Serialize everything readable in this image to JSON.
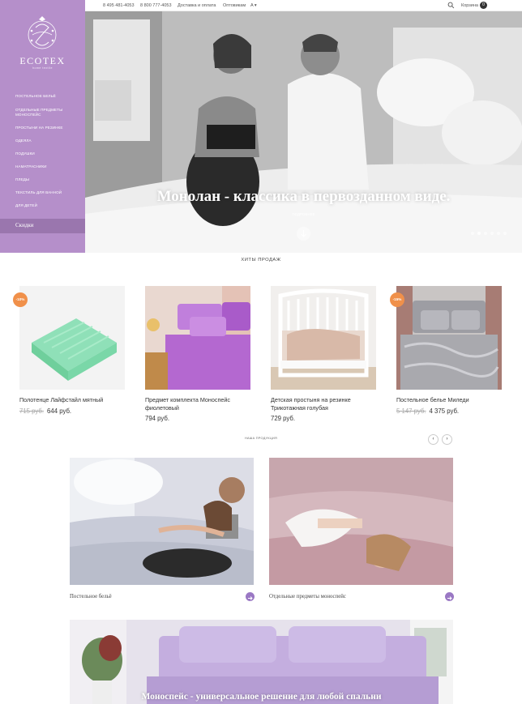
{
  "topbar": {
    "phone1": "8 495 481-4053",
    "phone2": "8 800 777-4053",
    "delivery": "Доставка и оплата",
    "wholesale": "Оптовикам",
    "lang": "A",
    "cart_label": "Корзина",
    "cart_count": "0"
  },
  "logo": {
    "name": "ECOTEX",
    "tagline": "home textile"
  },
  "sidebar": {
    "items": [
      {
        "label": "Постельное бельё"
      },
      {
        "label": "Отдельные предметы моноспейс"
      },
      {
        "label": "Простыни на резинке"
      },
      {
        "label": "Одеяла"
      },
      {
        "label": "Подушки"
      },
      {
        "label": "Наматрасники"
      },
      {
        "label": "Пледы"
      },
      {
        "label": "Текстиль для ванной"
      },
      {
        "label": "Для детей"
      }
    ],
    "sale": "Скидки"
  },
  "hero": {
    "title": "Монолан - классика в первозданном виде.",
    "more": "Подробнее",
    "slides": 6,
    "active_slide": 1
  },
  "hits": {
    "heading": "ХИТЫ ПРОДАЖ",
    "products": [
      {
        "name": "Полотенце Лайфстайл мятный",
        "old_price": "715 руб.",
        "price": "644 руб.",
        "badge": "-10%"
      },
      {
        "name": "Предмет комплекта Моноспейс фиолетовый",
        "old_price": "",
        "price": "794 руб.",
        "badge": ""
      },
      {
        "name": "Детская простыня на резинке Трикотажная голубая",
        "old_price": "",
        "price": "729 руб.",
        "badge": ""
      },
      {
        "name": "Постельное белье Миледи",
        "old_price": "5 147 руб.",
        "price": "4 375 руб.",
        "badge": "-15%"
      }
    ]
  },
  "products_section": {
    "heading": "НАША ПРОДУКЦИЯ",
    "prev": "‹",
    "next": "›"
  },
  "categories": [
    {
      "label": "Постельное бельё"
    },
    {
      "label": "Отдельные предметы моноспейс"
    }
  ],
  "promo": {
    "title": "Моноспейс - универсальное решение для любой спальни"
  },
  "colors": {
    "sidebar": "#b58fca",
    "accent": "#9a78c4",
    "badge": "#f0904a"
  }
}
